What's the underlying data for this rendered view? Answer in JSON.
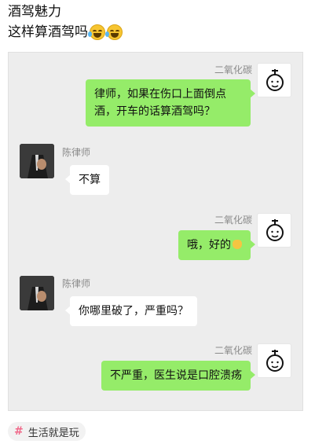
{
  "post": {
    "title": "酒驾魅力",
    "caption": "这样算酒驾吗",
    "caption_emojis": [
      "laughing-tears-emoji",
      "laughing-tears-emoji"
    ]
  },
  "chat": {
    "background": "#ededed",
    "bubble_green": "#95ec69",
    "messages": [
      {
        "side": "right",
        "sender": "二氧化碳",
        "text": "律师，如果在伤口上面倒点酒，开车的话算酒驾吗？"
      },
      {
        "side": "left",
        "sender": "陈律师",
        "text": "不算"
      },
      {
        "side": "right",
        "sender": "二氧化碳",
        "text": "哦，好的"
      },
      {
        "side": "left",
        "sender": "陈律师",
        "text": "你哪里破了，严重吗？"
      },
      {
        "side": "right",
        "sender": "二氧化碳",
        "text": "不严重，医生说是口腔溃疡"
      }
    ]
  },
  "tag": {
    "label": "生活就是玩",
    "icon": "hashtag-icon"
  }
}
